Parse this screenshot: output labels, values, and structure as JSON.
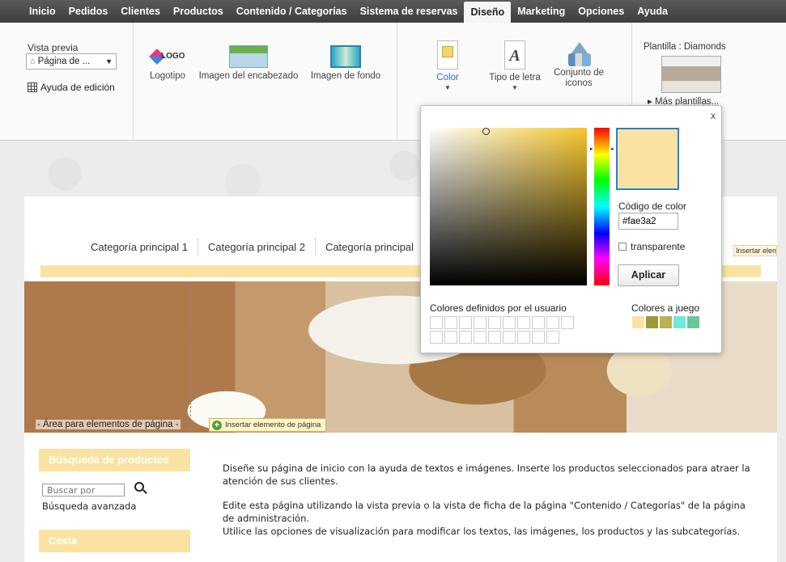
{
  "menu": [
    "Inicio",
    "Pedidos",
    "Clientes",
    "Productos",
    "Contenido / Categorías",
    "Sistema de reservas",
    "Diseño",
    "Marketing",
    "Opciones",
    "Ayuda"
  ],
  "menu_active": "Diseño",
  "ribbon": {
    "vista_previa_label": "Vista previa",
    "vista_previa_value": "Página de ...",
    "ayuda_edicion": "Ayuda de edición",
    "logotipo": "Logotipo",
    "imagen_encabezado": "Imagen del encabezado",
    "imagen_fondo": "Imagen de fondo",
    "color": "Color",
    "tipo_letra": "Tipo de letra",
    "conjunto_iconos_1": "Conjunto de",
    "conjunto_iconos_2": "iconos",
    "logo_text": "LOGO",
    "font_glyph": "A",
    "plantilla": "Plantilla : Diamonds",
    "mas_plantillas": "▸ Más plantillas..."
  },
  "page": {
    "categories": [
      "Categoría principal 1",
      "Categoría principal 2",
      "Categoría principal"
    ],
    "insert_right": "Insertar elemento",
    "area_label": "- Área para elementos de página -",
    "insert_btn": "Insertar elemento de página",
    "sidebar_search_title": "Búsqueda de productos",
    "search_placeholder": "Buscar por",
    "advanced_search": "Búsqueda avanzada",
    "cart_title": "Cesta",
    "text_p1": "Diseñe su página de inicio con la ayuda de textos e imágenes. Inserte los productos seleccionados para atraer la atención de sus clientes.",
    "text_p2a": "Edite esta página utilizando la vista previa o la vista de ficha de la página \"Contenido / Categorías\" de la página de administración.",
    "text_p2b": "Utilice las opciones de visualización para modificar los textos, las imágenes, los productos y las subcategorías."
  },
  "picker": {
    "close": "x",
    "code_label": "Código de color",
    "code_value": "#fae3a2",
    "transparent": "transparente",
    "apply": "Aplicar",
    "user_colors": "Colores definidos por el usuario",
    "matching_colors": "Colores a juego",
    "matching_swatches": [
      "#fae3a2",
      "#9b9a37",
      "#bab058",
      "#6fe8d9",
      "#6dc69a"
    ],
    "user_swatch_count": 19
  },
  "colors": {
    "accent": "#fae3a2",
    "menubar": "#4a4a4a",
    "link_blue": "#2a6fb3"
  }
}
